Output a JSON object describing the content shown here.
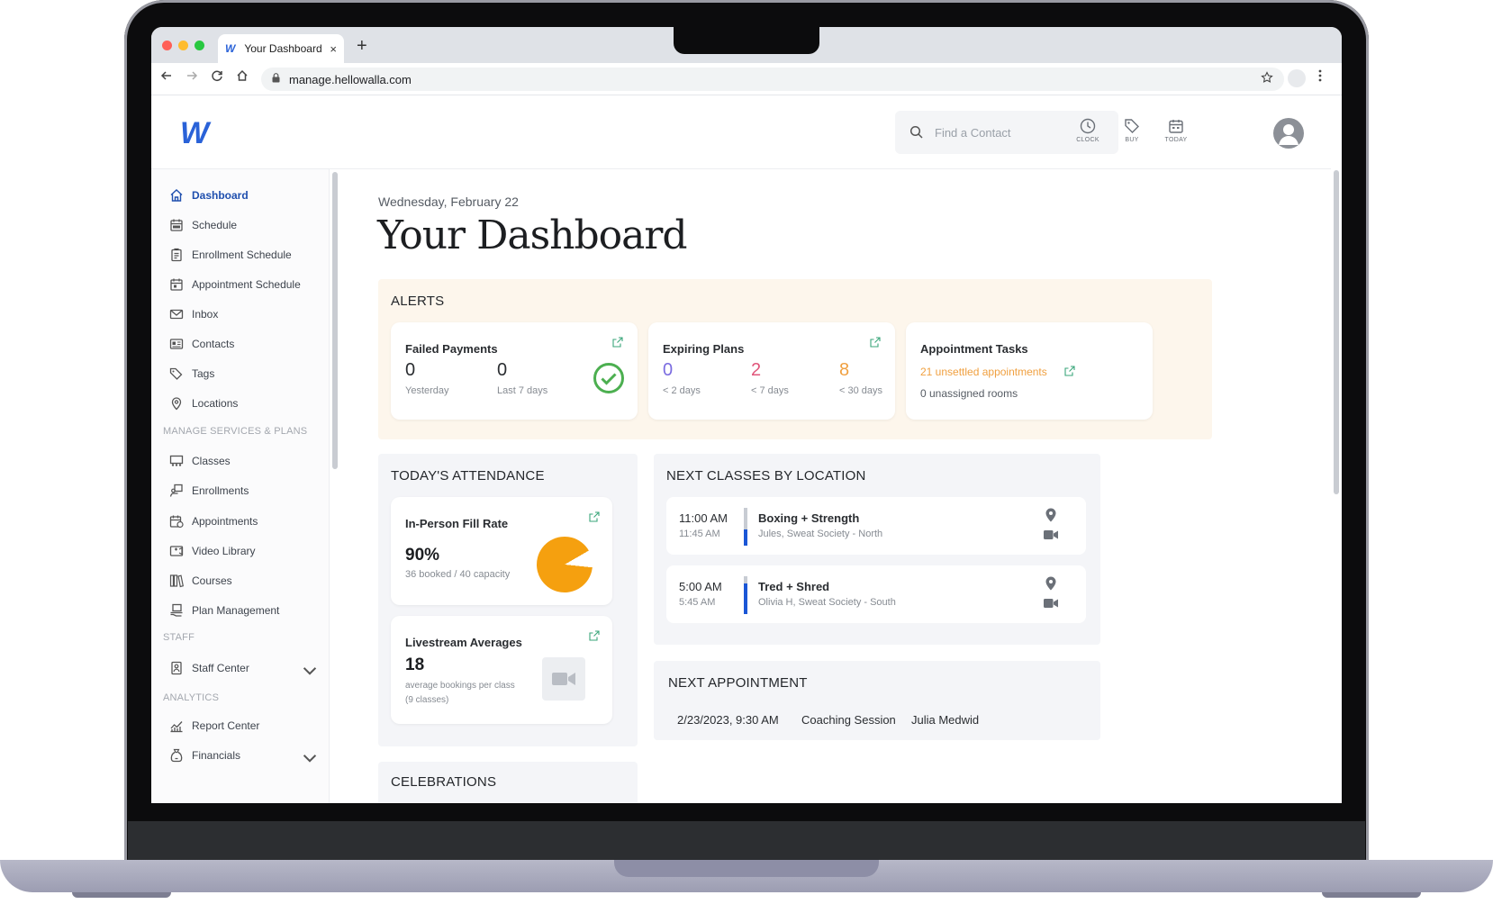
{
  "browser": {
    "tab_title": "Your Dashboard",
    "tab_favicon": "W",
    "new_tab": "+",
    "close_tab": "×",
    "url": "manage.hellowalla.com"
  },
  "header": {
    "logo_text": "W",
    "search_placeholder": "Find a Contact",
    "icons": [
      {
        "label": "CLOCK",
        "icon": "clock-icon"
      },
      {
        "label": "BUY",
        "icon": "tag-icon"
      },
      {
        "label": "TODAY",
        "icon": "calendar-icon"
      }
    ]
  },
  "sidebar": {
    "items": [
      {
        "label": "Dashboard",
        "icon": "home-icon",
        "active": true
      },
      {
        "label": "Schedule",
        "icon": "calendar-icon"
      },
      {
        "label": "Enrollment Schedule",
        "icon": "clipboard-icon"
      },
      {
        "label": "Appointment Schedule",
        "icon": "calendar-check-icon"
      },
      {
        "label": "Inbox",
        "icon": "mail-icon"
      },
      {
        "label": "Contacts",
        "icon": "contact-card-icon"
      },
      {
        "label": "Tags",
        "icon": "tags-icon"
      },
      {
        "label": "Locations",
        "icon": "map-pin-icon"
      }
    ],
    "section_services": "MANAGE SERVICES & PLANS",
    "service_items": [
      {
        "label": "Classes",
        "icon": "classes-icon"
      },
      {
        "label": "Enrollments",
        "icon": "enrollments-icon"
      },
      {
        "label": "Appointments",
        "icon": "appointments-icon"
      },
      {
        "label": "Video Library",
        "icon": "video-library-icon"
      },
      {
        "label": "Courses",
        "icon": "courses-icon"
      },
      {
        "label": "Plan Management",
        "icon": "plan-icon"
      }
    ],
    "section_staff": "STAFF",
    "staff_items": [
      {
        "label": "Staff Center",
        "icon": "staff-badge-icon",
        "expandable": true
      }
    ],
    "section_analytics": "ANALYTICS",
    "analytics_items": [
      {
        "label": "Report Center",
        "icon": "report-chart-icon"
      },
      {
        "label": "Financials",
        "icon": "money-bag-icon",
        "expandable": true
      }
    ]
  },
  "main": {
    "date": "Wednesday, February 22",
    "title": "Your Dashboard",
    "alerts": {
      "title": "ALERTS",
      "failed_payments": {
        "title": "Failed Payments",
        "yesterday_value": "0",
        "yesterday_label": "Yesterday",
        "week_value": "0",
        "week_label": "Last 7 days",
        "status_color": "#4caf50"
      },
      "expiring_plans": {
        "title": "Expiring Plans",
        "v1": "0",
        "l1": "< 2 days",
        "c1": "#7b6ce0",
        "v2": "2",
        "l2": "< 7 days",
        "c2": "#e0557a",
        "v3": "8",
        "l3": "< 30 days",
        "c3": "#f0a040"
      },
      "appointment_tasks": {
        "title": "Appointment Tasks",
        "unsettled": "21 unsettled appointments",
        "unassigned": "0 unassigned rooms"
      }
    },
    "attendance": {
      "title": "TODAY'S ATTENDANCE",
      "fill_rate": {
        "title": "In-Person Fill Rate",
        "value": "90%",
        "detail": "36 booked / 40 capacity",
        "fraction": 0.9
      },
      "livestream": {
        "title": "Livestream Averages",
        "value": "18",
        "detail_1": "average bookings per class",
        "detail_2": "(9 classes)"
      }
    },
    "next_classes": {
      "title": "NEXT CLASSES BY LOCATION",
      "rows": [
        {
          "start": "11:00 AM",
          "end": "11:45 AM",
          "name": "Boxing + Strength",
          "sub": "Jules, Sweat Society - North"
        },
        {
          "start": "5:00 AM",
          "end": "5:45 AM",
          "name": "Tred + Shred",
          "sub": "Olivia H, Sweat Society - South"
        }
      ]
    },
    "next_appointment": {
      "title": "NEXT APPOINTMENT",
      "datetime": "2/23/2023, 9:30 AM",
      "type": "Coaching Session",
      "client": "Julia Medwid"
    },
    "celebrations": {
      "title": "CELEBRATIONS"
    }
  },
  "colors": {
    "accent": "#1f4fae",
    "alerts_bg": "#fdf6ec",
    "pie_fill": "#f5a00f",
    "link_orange": "#f0a040"
  }
}
